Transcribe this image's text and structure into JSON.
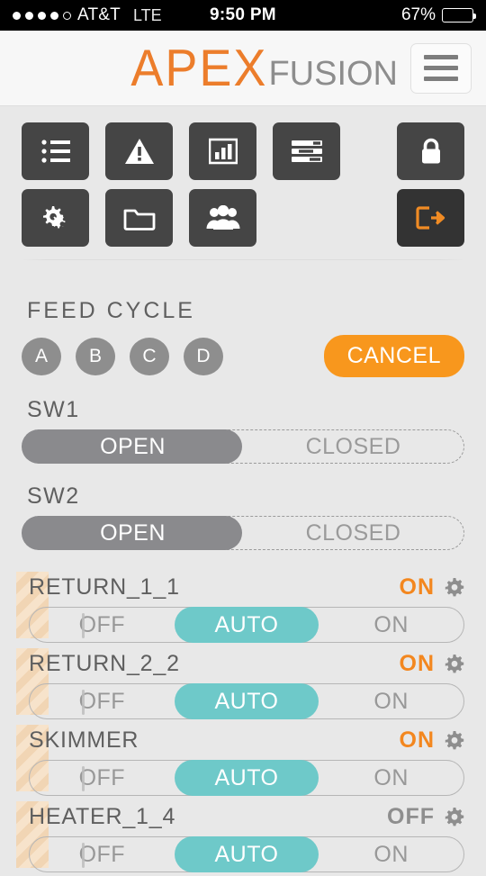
{
  "statusbar": {
    "signal_dots_filled": 4,
    "signal_dots_total": 5,
    "carrier": "AT&T",
    "network": "LTE",
    "time": "9:50 PM",
    "battery_pct": "67%",
    "battery_level": 67
  },
  "header": {
    "logo_primary": "APEX",
    "logo_secondary": "FUSION",
    "menu_icon": "hamburger-icon"
  },
  "toolbar": {
    "row1": [
      {
        "name": "list-icon",
        "label": "Outlets"
      },
      {
        "name": "warning-triangle-icon",
        "label": "Alerts"
      },
      {
        "name": "bar-chart-icon",
        "label": "Charts"
      },
      {
        "name": "sliders-icon",
        "label": "Inputs"
      }
    ],
    "row1_right": [
      {
        "name": "lock-icon",
        "label": "Lock"
      }
    ],
    "row2": [
      {
        "name": "cogs-icon",
        "label": "Settings"
      },
      {
        "name": "folder-icon",
        "label": "Files"
      },
      {
        "name": "users-icon",
        "label": "Users"
      }
    ],
    "row2_right": [
      {
        "name": "logout-icon",
        "label": "Sign Out"
      }
    ]
  },
  "feed_cycle": {
    "title": "FEED CYCLE",
    "buttons": [
      "A",
      "B",
      "C",
      "D"
    ],
    "cancel_label": "CANCEL"
  },
  "switches": [
    {
      "label": "SW1",
      "options": [
        "OPEN",
        "CLOSED"
      ],
      "selected": "OPEN"
    },
    {
      "label": "SW2",
      "options": [
        "OPEN",
        "CLOSED"
      ],
      "selected": "OPEN"
    }
  ],
  "outlets": [
    {
      "name": "RETURN_1_1",
      "state": "ON",
      "state_kind": "on",
      "options": [
        "OFF",
        "AUTO",
        "ON"
      ],
      "selected": "AUTO"
    },
    {
      "name": "RETURN_2_2",
      "state": "ON",
      "state_kind": "on",
      "options": [
        "OFF",
        "AUTO",
        "ON"
      ],
      "selected": "AUTO"
    },
    {
      "name": "SKIMMER",
      "state": "ON",
      "state_kind": "on",
      "options": [
        "OFF",
        "AUTO",
        "ON"
      ],
      "selected": "AUTO"
    },
    {
      "name": "HEATER_1_4",
      "state": "OFF",
      "state_kind": "off",
      "options": [
        "OFF",
        "AUTO",
        "ON"
      ],
      "selected": "AUTO"
    }
  ],
  "colors": {
    "accent_orange": "#f8971d",
    "logo_orange": "#ec7d2b",
    "auto_teal": "#6ec9c9",
    "toolbar_dark": "#454545",
    "page_bg": "#e8e8e8",
    "indicator_peach": "#f7e3cb"
  }
}
